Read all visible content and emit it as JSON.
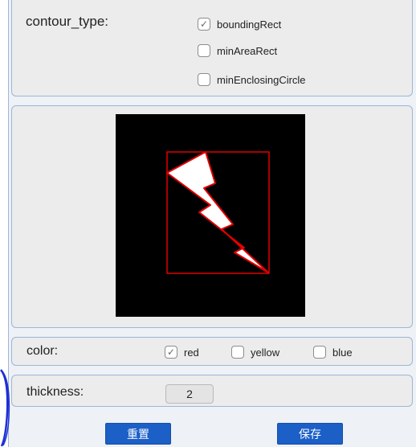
{
  "contour": {
    "label": "contour_type:",
    "options": [
      {
        "label": "boundingRect",
        "checked": true
      },
      {
        "label": "minAreaRect",
        "checked": false
      },
      {
        "label": "minEnclosingCircle",
        "checked": false
      }
    ]
  },
  "preview": {
    "background": "#000000",
    "shape_fill": "#ffffff",
    "contour_color": "#ff0000"
  },
  "color": {
    "label": "color:",
    "options": [
      {
        "label": "red",
        "checked": true
      },
      {
        "label": "yellow",
        "checked": false
      },
      {
        "label": "blue",
        "checked": false
      }
    ]
  },
  "thickness": {
    "label": "thickness:",
    "value": "2"
  },
  "buttons": {
    "reset": "重置",
    "save": "保存"
  },
  "check_glyph": "✓"
}
